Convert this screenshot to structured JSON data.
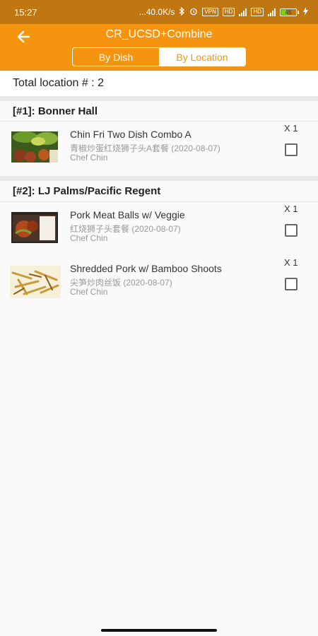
{
  "status_bar": {
    "time": "15:27",
    "net_speed": "...40.0K/s",
    "vpn": "VPN",
    "hd1": "HD",
    "hd2": "HD",
    "battery_level": "45",
    "battery_fraction": 0.45,
    "icons": [
      "bluetooth-icon",
      "alarm-icon",
      "vpn-icon",
      "signal-icon",
      "battery-icon",
      "charging-icon"
    ]
  },
  "appbar": {
    "title": "CR_UCSD+Combine",
    "back_icon": "arrow-left-icon",
    "tabs": [
      {
        "label": "By Dish",
        "selected": false
      },
      {
        "label": "By Location",
        "selected": true
      }
    ],
    "accent_color": "#f5950f"
  },
  "summary": {
    "total_label": "Total location # : 2"
  },
  "locations": [
    {
      "title": "[#1]: Bonner Hall",
      "items": [
        {
          "name": "Chin Fri Two Dish Combo A",
          "subtitle": "青椒炒蛋红烧狮子头A套餐 (2020-08-07)",
          "chef": "Chef Chin",
          "qty": "X 1",
          "checked": false
        }
      ]
    },
    {
      "title": "[#2]: LJ Palms/Pacific Regent",
      "items": [
        {
          "name": "Pork Meat Balls w/ Veggie",
          "subtitle": "红烧狮子头套餐 (2020-08-07)",
          "chef": "Chef Chin",
          "qty": "X 1",
          "checked": false
        },
        {
          "name": "Shredded Pork w/ Bamboo Shoots",
          "subtitle": "尖笋炒肉丝饭 (2020-08-07)",
          "chef": "Chef Chin",
          "qty": "X 1",
          "checked": false
        }
      ]
    }
  ]
}
